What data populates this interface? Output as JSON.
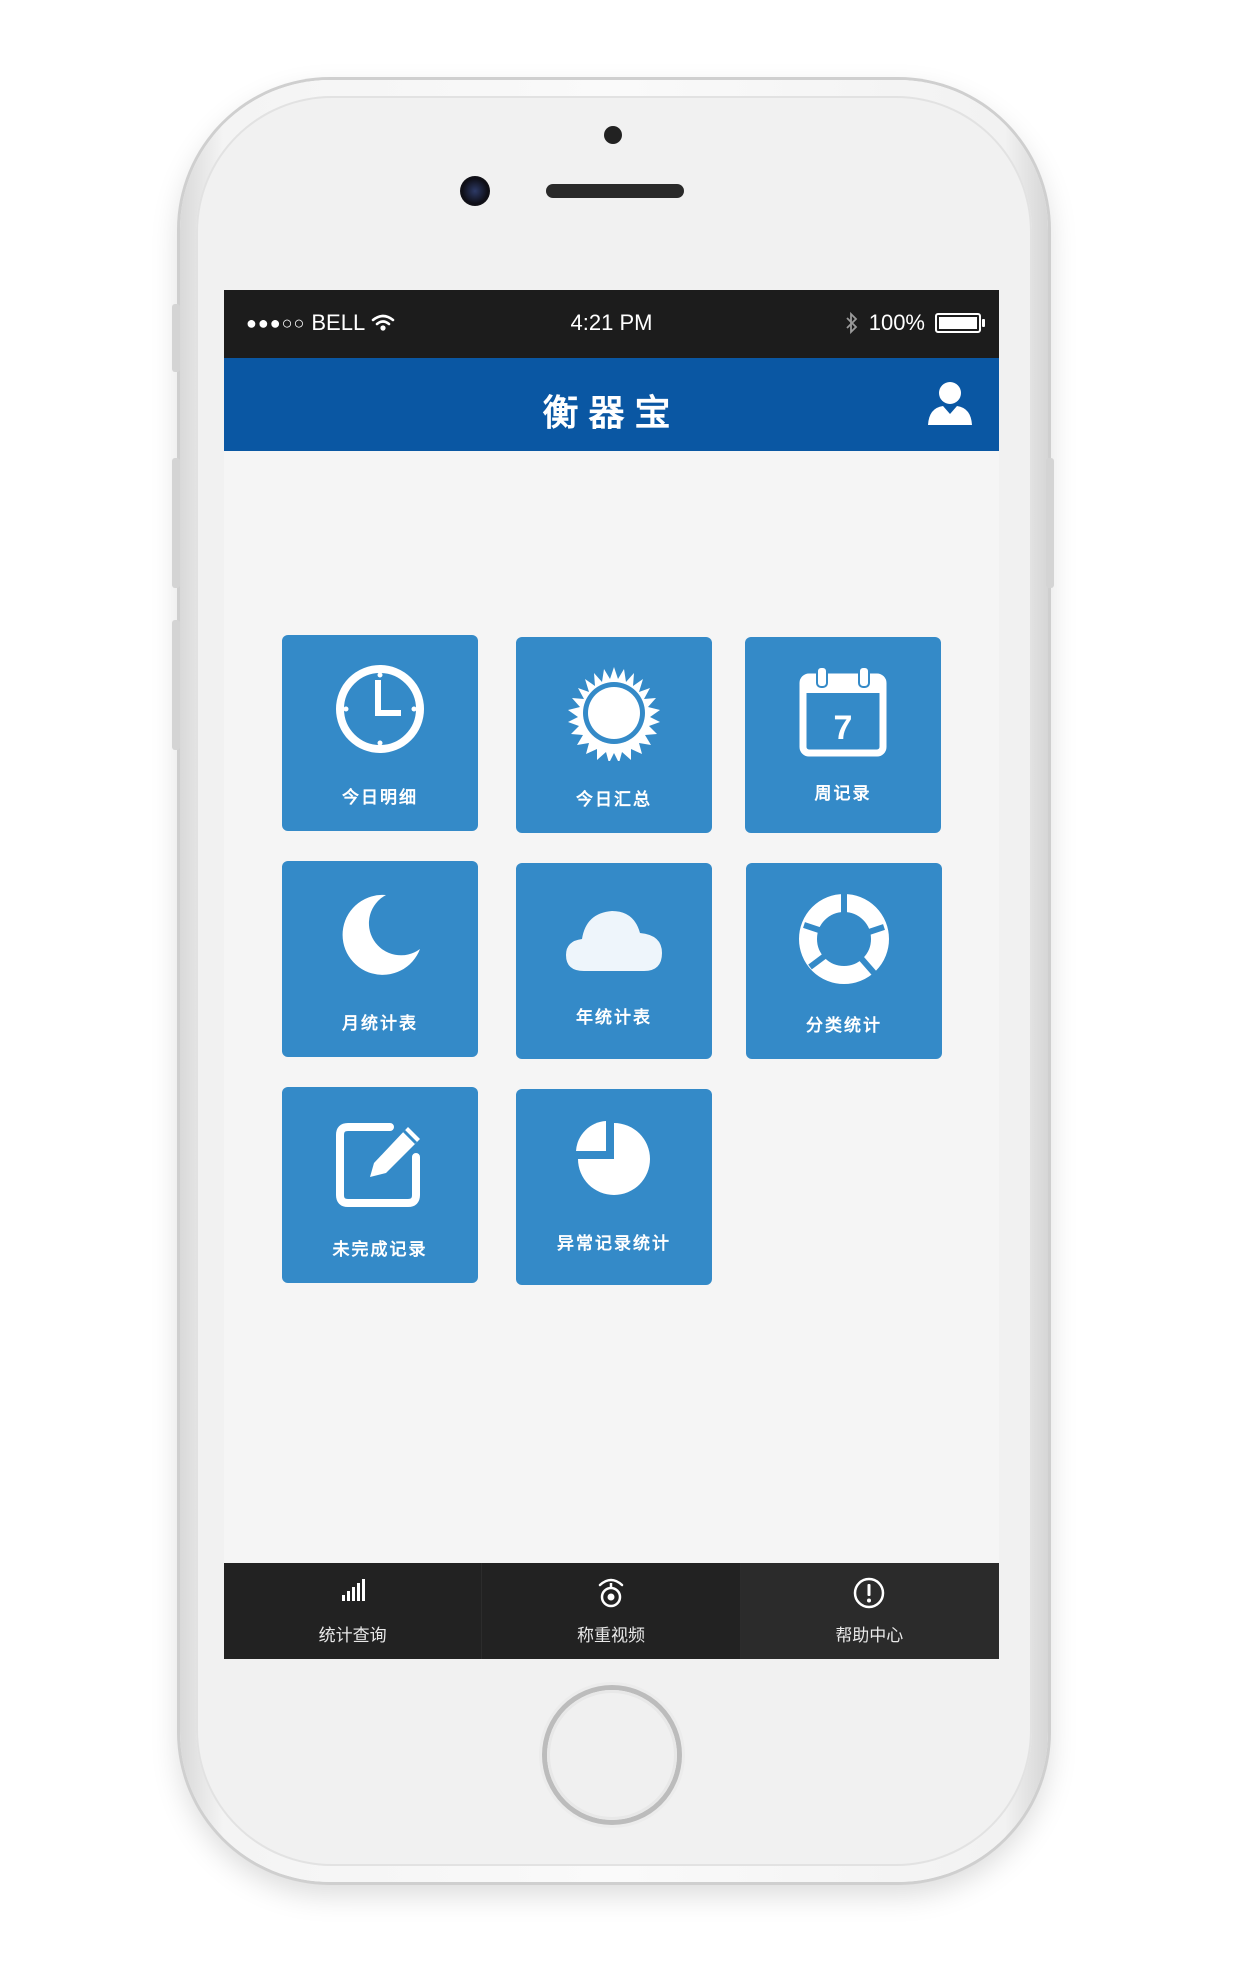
{
  "status_bar": {
    "signal": "●●●○○",
    "carrier": "BELL",
    "time": "4:21 PM",
    "battery": "100%"
  },
  "nav": {
    "title": "衡器宝"
  },
  "tiles": [
    {
      "label": "今日明细",
      "icon": "clock-icon"
    },
    {
      "label": "今日汇总",
      "icon": "sun-icon"
    },
    {
      "label": "周记录",
      "icon": "calendar-icon",
      "calendar_day": "7"
    },
    {
      "label": "月统计表",
      "icon": "moon-icon"
    },
    {
      "label": "年统计表",
      "icon": "cloud-icon"
    },
    {
      "label": "分类统计",
      "icon": "donut-icon"
    },
    {
      "label": "未完成记录",
      "icon": "edit-icon"
    },
    {
      "label": "异常记录统计",
      "icon": "pie-chart-icon"
    }
  ],
  "tab_bar": {
    "items": [
      {
        "label": "统计查询",
        "icon": "bar-signal-icon"
      },
      {
        "label": "称重视频",
        "icon": "webcam-icon"
      },
      {
        "label": "帮助中心",
        "icon": "exclamation-circle-icon"
      }
    ],
    "active_index": 2
  },
  "colors": {
    "nav": "#0a57a3",
    "tile": "#348ac8",
    "status_bar": "#1c1c1c",
    "tab_bar": "#222222",
    "background": "#f5f5f5"
  }
}
